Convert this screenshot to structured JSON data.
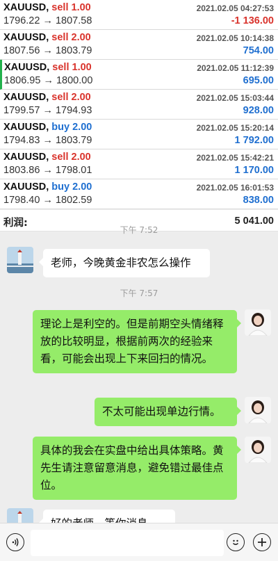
{
  "trades": [
    {
      "symbol": "XAUUSD,",
      "side": "sell 1.00",
      "side_type": "sell",
      "time": "2021.02.05 04:27:53",
      "prices": "1796.22 → 1807.58",
      "profit": "-1 136.00",
      "profit_sign": "neg"
    },
    {
      "symbol": "XAUUSD,",
      "side": "sell 2.00",
      "side_type": "sell",
      "time": "2021.02.05 10:14:38",
      "prices": "1807.56 → 1803.79",
      "profit": "754.00",
      "profit_sign": "pos"
    },
    {
      "symbol": "XAUUSD,",
      "side": "sell 1.00",
      "side_type": "sell",
      "time": "2021.02.05 11:12:39",
      "prices": "1806.95 → 1800.00",
      "profit": "695.00",
      "profit_sign": "pos"
    },
    {
      "symbol": "XAUUSD,",
      "side": "sell 2.00",
      "side_type": "sell",
      "time": "2021.02.05 15:03:44",
      "prices": "1799.57 → 1794.93",
      "profit": "928.00",
      "profit_sign": "pos"
    },
    {
      "symbol": "XAUUSD,",
      "side": "buy 2.00",
      "side_type": "buy",
      "time": "2021.02.05 15:20:14",
      "prices": "1794.83 → 1803.79",
      "profit": "1 792.00",
      "profit_sign": "pos"
    },
    {
      "symbol": "XAUUSD,",
      "side": "sell 2.00",
      "side_type": "sell",
      "time": "2021.02.05 15:42:21",
      "prices": "1803.86 → 1798.01",
      "profit": "1 170.00",
      "profit_sign": "pos"
    },
    {
      "symbol": "XAUUSD,",
      "side": "buy 2.00",
      "side_type": "buy",
      "time": "2021.02.05 16:01:53",
      "prices": "1798.40 → 1802.59",
      "profit": "838.00",
      "profit_sign": "pos"
    }
  ],
  "total": {
    "label": "利润:",
    "amount": "5 041.00"
  },
  "chat": {
    "timestamps": [
      "下午 7:52",
      "下午 7:57"
    ],
    "messages": [
      {
        "from": "user",
        "text": "老师，今晚黄金非农怎么操作"
      },
      {
        "from": "teacher",
        "text": "理论上是利空的。但是前期空头情绪释放的比较明显，根据前两次的经验来看，可能会出现上下来回扫的情况。"
      },
      {
        "from": "teacher",
        "text": "不太可能出现单边行情。"
      },
      {
        "from": "teacher",
        "text": "具体的我会在实盘中给出具体策略。黄先生请注意留意消息，避免错过最佳点位。"
      },
      {
        "from": "user",
        "text": "好的老师，等你消息"
      }
    ]
  },
  "input_bar": {
    "voice_icon": "voice-icon",
    "emoji_icon": "emoji-icon",
    "plus_icon": "plus-icon"
  },
  "colors": {
    "sell": "#d9332c",
    "buy": "#1f6fd0",
    "bubble_out": "#95ec69",
    "chat_bg": "#ededed"
  }
}
